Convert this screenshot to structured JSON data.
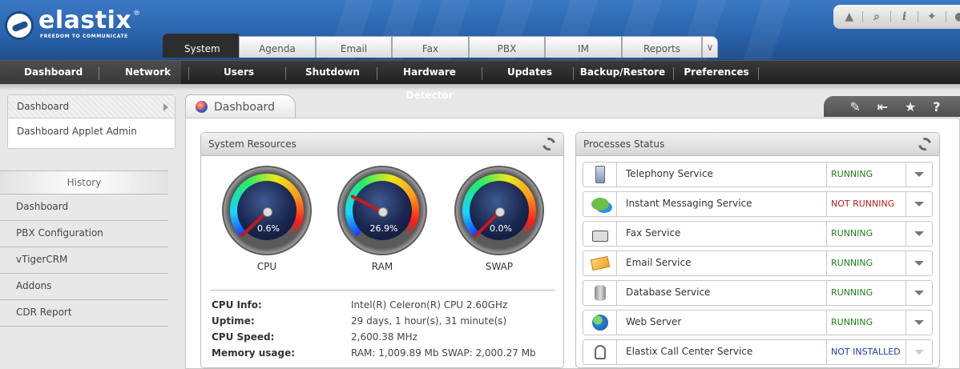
{
  "app": {
    "logo_text": "elastix",
    "logo_reg": "®",
    "logo_slogan": "FREEDOM TO COMMUNICATE",
    "tool_icons": [
      "drop-icon",
      "search-icon",
      "info-icon",
      "puzzle-icon",
      "user-icon"
    ]
  },
  "tabs": [
    "System",
    "Agenda",
    "Email",
    "Fax",
    "PBX",
    "IM",
    "Reports"
  ],
  "active_tab": "System",
  "menu": [
    "Dashboard",
    "Network",
    "Users",
    "Shutdown",
    "Hardware Detector",
    "Updates",
    "Backup/Restore",
    "Preferences"
  ],
  "active_menu": "Dashboard",
  "sidebar": {
    "dashboard": "Dashboard",
    "applet_admin": "Dashboard Applet Admin",
    "history_title": "History",
    "history": [
      "Dashboard",
      "PBX Configuration",
      "vTigerCRM",
      "Addons",
      "CDR Report"
    ]
  },
  "content": {
    "tab_title": "Dashboard",
    "toolbar_icons": [
      "edit-icon",
      "collapse-icon",
      "star-icon",
      "help-icon"
    ]
  },
  "system_resources": {
    "title": "System Resources",
    "gauges": [
      {
        "label": "CPU",
        "value": "0.6%",
        "percent": 0.6
      },
      {
        "label": "RAM",
        "value": "26.9%",
        "percent": 26.9
      },
      {
        "label": "SWAP",
        "value": "0.0%",
        "percent": 0.0
      }
    ],
    "info": [
      {
        "key": "CPU Info:",
        "value": "Intel(R) Celeron(R) CPU 2.60GHz"
      },
      {
        "key": "Uptime:",
        "value": "29 days, 1 hour(s), 31 minute(s)"
      },
      {
        "key": "CPU Speed:",
        "value": "2,600.38 MHz"
      },
      {
        "key": "Memory usage:",
        "value": "RAM: 1,009.89 Mb SWAP: 2,000.27 Mb"
      }
    ]
  },
  "processes": {
    "title": "Processes Status",
    "items": [
      {
        "name": "Telephony Service",
        "status": "RUNNING",
        "icon": "phone-icon"
      },
      {
        "name": "Instant Messaging Service",
        "status": "NOT RUNNING",
        "icon": "chat-icon"
      },
      {
        "name": "Fax Service",
        "status": "RUNNING",
        "icon": "fax-icon"
      },
      {
        "name": "Email Service",
        "status": "RUNNING",
        "icon": "envelope-icon"
      },
      {
        "name": "Database Service",
        "status": "RUNNING",
        "icon": "database-icon"
      },
      {
        "name": "Web Server",
        "status": "RUNNING",
        "icon": "globe-icon"
      },
      {
        "name": "Elastix Call Center Service",
        "status": "NOT INSTALLED",
        "icon": "headset-icon"
      }
    ]
  },
  "colors": {
    "running": "#1e7f1e",
    "not_running": "#c01818",
    "not_installed": "#1a3c9c",
    "header_blue": "#2a64ad",
    "menubar": "#2a2a2a"
  }
}
